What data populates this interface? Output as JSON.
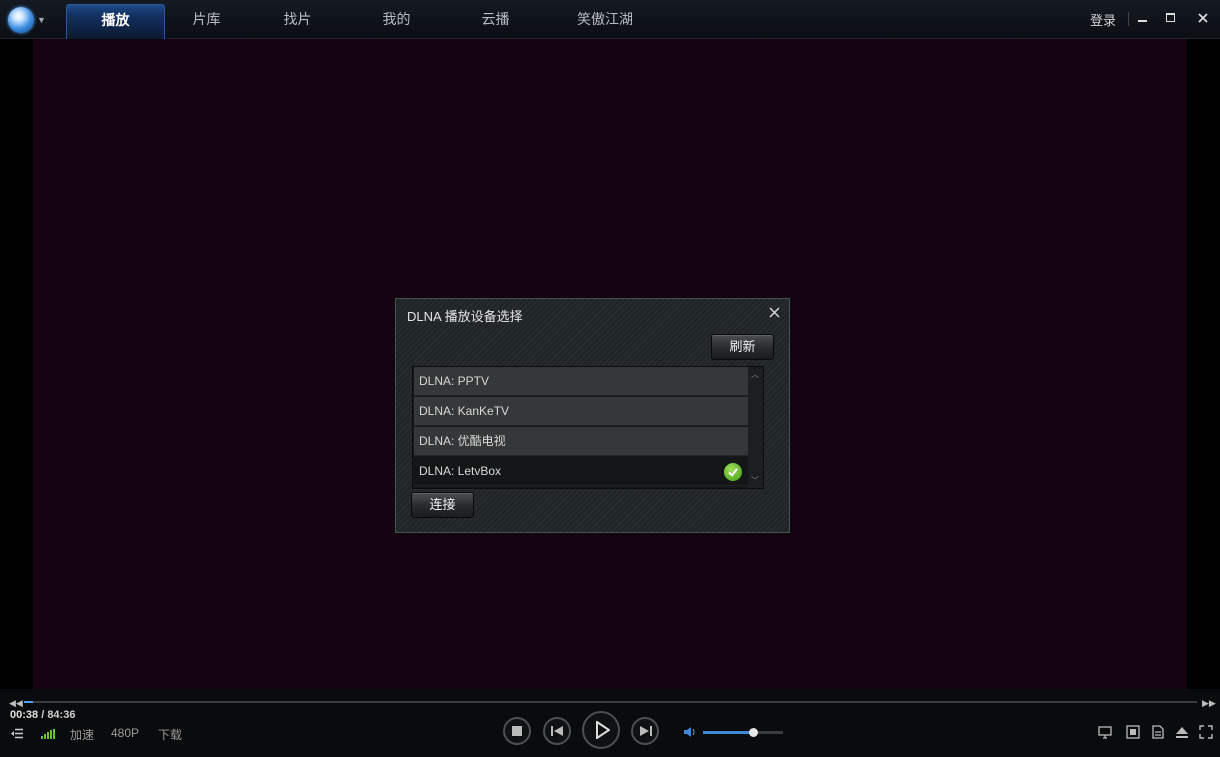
{
  "header": {
    "tabs": [
      {
        "label": "播放",
        "active": true
      },
      {
        "label": "片库",
        "active": false
      },
      {
        "label": "找片",
        "active": false
      },
      {
        "label": "我的",
        "active": false
      },
      {
        "label": "云播",
        "active": false
      },
      {
        "label": "笑傲江湖",
        "active": false
      }
    ],
    "login_label": "登录"
  },
  "dialog": {
    "title": "DLNA 播放设备选择",
    "refresh_label": "刷新",
    "connect_label": "连接",
    "devices": [
      {
        "label": "DLNA: PPTV",
        "selected": false
      },
      {
        "label": "DLNA: KanKeTV",
        "selected": false
      },
      {
        "label": "DLNA: 优酷电视",
        "selected": false
      },
      {
        "label": "DLNA: LetvBox",
        "selected": true
      }
    ]
  },
  "player": {
    "current_time": "00:38",
    "total_time": "/ 84:36",
    "progress_fraction": 0.0075,
    "accelerate_label": "加速",
    "quality_label": "480P",
    "download_label": "下载",
    "volume_fraction": 0.62
  },
  "colors": {
    "accent": "#4aa3ff",
    "video_bg": "#150212",
    "check": "#5bb61d"
  },
  "icons": {
    "app_logo": "globe-logo-icon",
    "check": "check-circle-icon"
  }
}
